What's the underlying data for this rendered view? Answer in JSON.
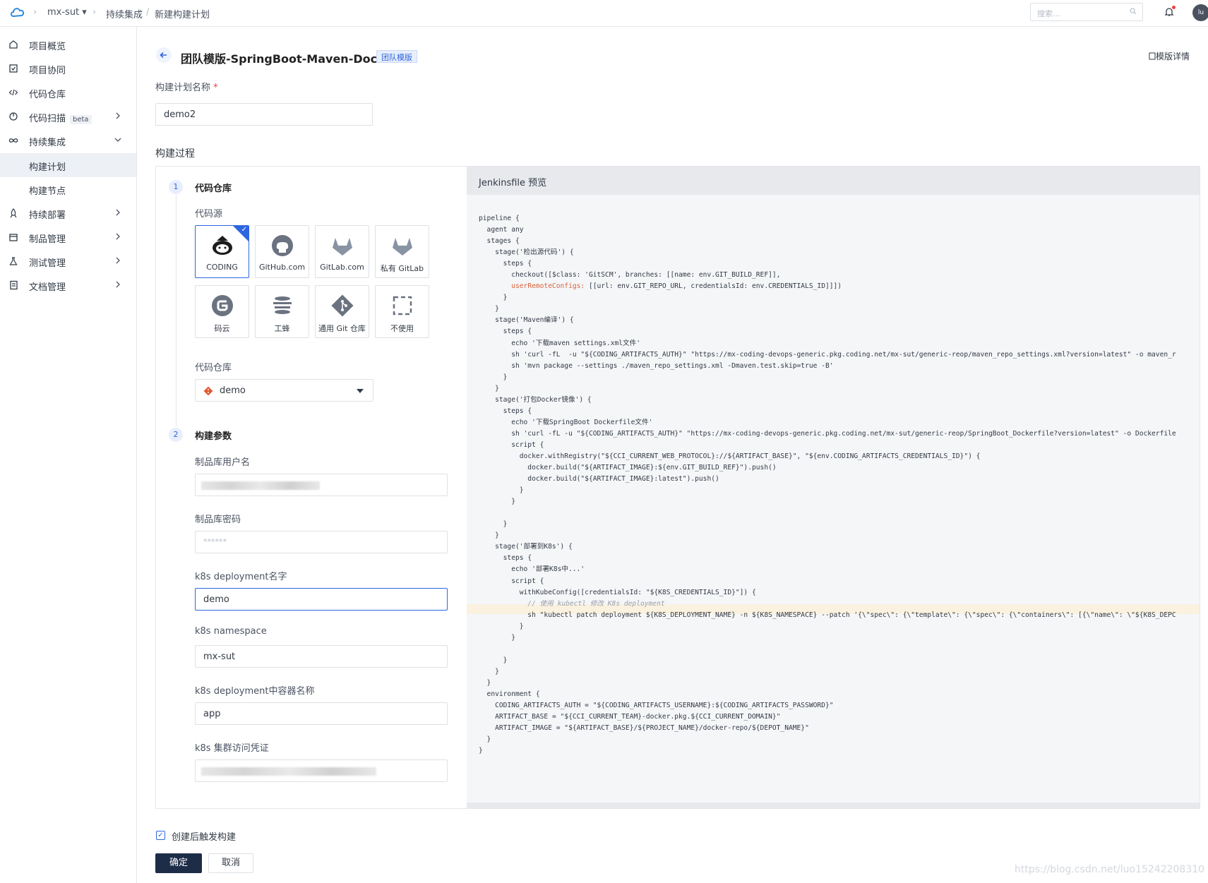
{
  "header": {
    "project": "mx-sut",
    "breadcrumb": [
      "持续集成",
      "新建构建计划"
    ],
    "search_placeholder": "搜索...",
    "avatar_text": "lu"
  },
  "sidebar": {
    "items": [
      {
        "label": "项目概览",
        "icon": "home-icon"
      },
      {
        "label": "项目协同",
        "icon": "checkbox-icon"
      },
      {
        "label": "代码仓库",
        "icon": "code-icon"
      },
      {
        "label": "代码扫描",
        "icon": "scan-icon",
        "badge": "beta"
      },
      {
        "label": "持续集成",
        "icon": "infinity-icon",
        "expanded": true
      },
      {
        "label": "构建计划",
        "sub": true,
        "active": true
      },
      {
        "label": "构建节点",
        "sub": true
      },
      {
        "label": "持续部署",
        "icon": "rocket-icon"
      },
      {
        "label": "制品管理",
        "icon": "box-icon"
      },
      {
        "label": "测试管理",
        "icon": "flask-icon"
      },
      {
        "label": "文档管理",
        "icon": "doc-icon"
      }
    ]
  },
  "page": {
    "title": "团队模版-SpringBoot-Maven-Docker",
    "tag": "团队模版",
    "template_detail": "模版详情",
    "plan_name_label": "构建计划名称",
    "plan_name_required": "*",
    "plan_name_value": "demo2",
    "process_label": "构建过程"
  },
  "step1": {
    "num": "1",
    "title": "代码仓库",
    "source_label": "代码源",
    "sources": [
      "CODING",
      "GitHub.com",
      "GitLab.com",
      "私有 GitLab",
      "码云",
      "工蜂",
      "通用 Git 仓库",
      "不使用"
    ],
    "selected": "CODING",
    "repo_label": "代码仓库",
    "repo_value": "demo"
  },
  "step2": {
    "num": "2",
    "title": "构建参数",
    "fields": [
      {
        "label": "制品库用户名",
        "value": ""
      },
      {
        "label": "制品库密码",
        "value": "******"
      },
      {
        "label": "k8s deployment名字",
        "value": "demo"
      },
      {
        "label": "k8s namespace",
        "value": "mx-sut"
      },
      {
        "label": "k8s deployment中容器名称",
        "value": "app"
      },
      {
        "label": "k8s 集群访问凭证",
        "value": ""
      }
    ]
  },
  "jenkins": {
    "title": "Jenkinsfile 预览",
    "lines": [
      "pipeline {",
      "  agent any",
      "  stages {",
      "    stage('检出源代码') {",
      "      steps {",
      "        checkout([$class: 'GitSCM', branches: [[name: env.GIT_BUILD_REF]],",
      "        userRemoteConfigs: [[url: env.GIT_REPO_URL, credentialsId: env.CREDENTIALS_ID]]])",
      "      }",
      "    }",
      "    stage('Maven编译') {",
      "      steps {",
      "        echo '下载maven settings.xml文件'",
      "        sh 'curl -fL  -u \"${CODING_ARTIFACTS_AUTH}\" \"https://mx-coding-devops-generic.pkg.coding.net/mx-sut/generic-reop/maven_repo_settings.xml?version=latest\" -o maven_r",
      "        sh 'mvn package --settings ./maven_repo_settings.xml -Dmaven.test.skip=true -B'",
      "      }",
      "    }",
      "    stage('打包Docker镜像') {",
      "      steps {",
      "        echo '下载SpringBoot Dockerfile文件'",
      "        sh 'curl -fL -u \"${CODING_ARTIFACTS_AUTH}\" \"https://mx-coding-devops-generic.pkg.coding.net/mx-sut/generic-reop/SpringBoot_Dockerfile?version=latest\" -o Dockerfile",
      "        script {",
      "          docker.withRegistry(\"${CCI_CURRENT_WEB_PROTOCOL}://${ARTIFACT_BASE}\", \"${env.CODING_ARTIFACTS_CREDENTIALS_ID}\") {",
      "            docker.build(\"${ARTIFACT_IMAGE}:${env.GIT_BUILD_REF}\").push()",
      "            docker.build(\"${ARTIFACT_IMAGE}:latest\").push()",
      "          }",
      "        }",
      "",
      "      }",
      "    }",
      "    stage('部署到K8s') {",
      "      steps {",
      "        echo '部署K8s中...'",
      "        script {",
      "          withKubeConfig([credentialsId: \"${K8S_CREDENTIALS_ID}\"]) {",
      "            // 使用 kubectl 修改 K8s deployment",
      "            sh \"kubectl patch deployment ${K8S_DEPLOYMENT_NAME} -n ${K8S_NAMESPACE} --patch '{\\\"spec\\\": {\\\"template\\\": {\\\"spec\\\": {\\\"containers\\\": [{\\\"name\\\": \\\"${K8S_DEPC",
      "          }",
      "        }",
      "",
      "      }",
      "    }",
      "  }",
      "  environment {",
      "    CODING_ARTIFACTS_AUTH = \"${CODING_ARTIFACTS_USERNAME}:${CODING_ARTIFACTS_PASSWORD}\"",
      "    ARTIFACT_BASE = \"${CCI_CURRENT_TEAM}-docker.pkg.${CCI_CURRENT_DOMAIN}\"",
      "    ARTIFACT_IMAGE = \"${ARTIFACT_BASE}/${PROJECT_NAME}/docker-repo/${DEPOT_NAME}\"",
      "  }",
      "}"
    ]
  },
  "footer": {
    "trigger_label": "创建后触发构建",
    "trigger_checked": true,
    "confirm": "确定",
    "cancel": "取消"
  },
  "watermark": "https://blog.csdn.net/luo15242208310",
  "colors": {
    "accent": "#2e66e0",
    "primary_button": "#1d2d47",
    "active_nav_bg": "#edf0f5"
  }
}
